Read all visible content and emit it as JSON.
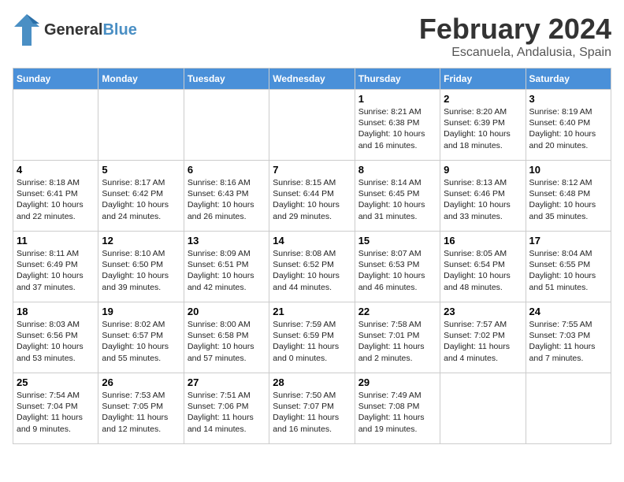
{
  "header": {
    "logo_general": "General",
    "logo_blue": "Blue",
    "month": "February 2024",
    "location": "Escanuela, Andalusia, Spain"
  },
  "days_of_week": [
    "Sunday",
    "Monday",
    "Tuesday",
    "Wednesday",
    "Thursday",
    "Friday",
    "Saturday"
  ],
  "weeks": [
    [
      {
        "day": "",
        "detail": ""
      },
      {
        "day": "",
        "detail": ""
      },
      {
        "day": "",
        "detail": ""
      },
      {
        "day": "",
        "detail": ""
      },
      {
        "day": "1",
        "detail": "Sunrise: 8:21 AM\nSunset: 6:38 PM\nDaylight: 10 hours\nand 16 minutes."
      },
      {
        "day": "2",
        "detail": "Sunrise: 8:20 AM\nSunset: 6:39 PM\nDaylight: 10 hours\nand 18 minutes."
      },
      {
        "day": "3",
        "detail": "Sunrise: 8:19 AM\nSunset: 6:40 PM\nDaylight: 10 hours\nand 20 minutes."
      }
    ],
    [
      {
        "day": "4",
        "detail": "Sunrise: 8:18 AM\nSunset: 6:41 PM\nDaylight: 10 hours\nand 22 minutes."
      },
      {
        "day": "5",
        "detail": "Sunrise: 8:17 AM\nSunset: 6:42 PM\nDaylight: 10 hours\nand 24 minutes."
      },
      {
        "day": "6",
        "detail": "Sunrise: 8:16 AM\nSunset: 6:43 PM\nDaylight: 10 hours\nand 26 minutes."
      },
      {
        "day": "7",
        "detail": "Sunrise: 8:15 AM\nSunset: 6:44 PM\nDaylight: 10 hours\nand 29 minutes."
      },
      {
        "day": "8",
        "detail": "Sunrise: 8:14 AM\nSunset: 6:45 PM\nDaylight: 10 hours\nand 31 minutes."
      },
      {
        "day": "9",
        "detail": "Sunrise: 8:13 AM\nSunset: 6:46 PM\nDaylight: 10 hours\nand 33 minutes."
      },
      {
        "day": "10",
        "detail": "Sunrise: 8:12 AM\nSunset: 6:48 PM\nDaylight: 10 hours\nand 35 minutes."
      }
    ],
    [
      {
        "day": "11",
        "detail": "Sunrise: 8:11 AM\nSunset: 6:49 PM\nDaylight: 10 hours\nand 37 minutes."
      },
      {
        "day": "12",
        "detail": "Sunrise: 8:10 AM\nSunset: 6:50 PM\nDaylight: 10 hours\nand 39 minutes."
      },
      {
        "day": "13",
        "detail": "Sunrise: 8:09 AM\nSunset: 6:51 PM\nDaylight: 10 hours\nand 42 minutes."
      },
      {
        "day": "14",
        "detail": "Sunrise: 8:08 AM\nSunset: 6:52 PM\nDaylight: 10 hours\nand 44 minutes."
      },
      {
        "day": "15",
        "detail": "Sunrise: 8:07 AM\nSunset: 6:53 PM\nDaylight: 10 hours\nand 46 minutes."
      },
      {
        "day": "16",
        "detail": "Sunrise: 8:05 AM\nSunset: 6:54 PM\nDaylight: 10 hours\nand 48 minutes."
      },
      {
        "day": "17",
        "detail": "Sunrise: 8:04 AM\nSunset: 6:55 PM\nDaylight: 10 hours\nand 51 minutes."
      }
    ],
    [
      {
        "day": "18",
        "detail": "Sunrise: 8:03 AM\nSunset: 6:56 PM\nDaylight: 10 hours\nand 53 minutes."
      },
      {
        "day": "19",
        "detail": "Sunrise: 8:02 AM\nSunset: 6:57 PM\nDaylight: 10 hours\nand 55 minutes."
      },
      {
        "day": "20",
        "detail": "Sunrise: 8:00 AM\nSunset: 6:58 PM\nDaylight: 10 hours\nand 57 minutes."
      },
      {
        "day": "21",
        "detail": "Sunrise: 7:59 AM\nSunset: 6:59 PM\nDaylight: 11 hours\nand 0 minutes."
      },
      {
        "day": "22",
        "detail": "Sunrise: 7:58 AM\nSunset: 7:01 PM\nDaylight: 11 hours\nand 2 minutes."
      },
      {
        "day": "23",
        "detail": "Sunrise: 7:57 AM\nSunset: 7:02 PM\nDaylight: 11 hours\nand 4 minutes."
      },
      {
        "day": "24",
        "detail": "Sunrise: 7:55 AM\nSunset: 7:03 PM\nDaylight: 11 hours\nand 7 minutes."
      }
    ],
    [
      {
        "day": "25",
        "detail": "Sunrise: 7:54 AM\nSunset: 7:04 PM\nDaylight: 11 hours\nand 9 minutes."
      },
      {
        "day": "26",
        "detail": "Sunrise: 7:53 AM\nSunset: 7:05 PM\nDaylight: 11 hours\nand 12 minutes."
      },
      {
        "day": "27",
        "detail": "Sunrise: 7:51 AM\nSunset: 7:06 PM\nDaylight: 11 hours\nand 14 minutes."
      },
      {
        "day": "28",
        "detail": "Sunrise: 7:50 AM\nSunset: 7:07 PM\nDaylight: 11 hours\nand 16 minutes."
      },
      {
        "day": "29",
        "detail": "Sunrise: 7:49 AM\nSunset: 7:08 PM\nDaylight: 11 hours\nand 19 minutes."
      },
      {
        "day": "",
        "detail": ""
      },
      {
        "day": "",
        "detail": ""
      }
    ]
  ]
}
